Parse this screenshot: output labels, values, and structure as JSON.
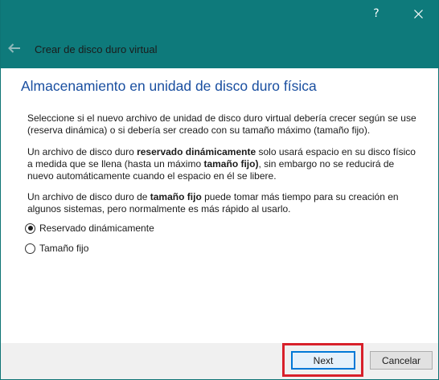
{
  "titlebar": {
    "help_label": "?",
    "close_icon": "close-icon",
    "background_color": "#0e7a7b"
  },
  "wizard": {
    "back_icon": "back-arrow-icon",
    "title": "Crear de disco duro virtual"
  },
  "page": {
    "heading": "Almacenamiento en unidad de disco duro física",
    "heading_color": "#1a4fa0",
    "paragraph1": "Seleccione si el nuevo archivo de unidad de disco duro virtual debería crecer según se use (reserva dinámica) o si debería ser creado con su tamaño máximo (tamaño fijo).",
    "paragraph2": {
      "part1": "Un archivo de disco duro ",
      "bold1": "reservado dinámicamente",
      "part2": " solo usará espacio en su disco físico a medida que se llena (hasta un máximo ",
      "bold2": "tamaño fijo)",
      "part3": ", sin embargo no se reducirá de nuevo automáticamente cuando el espacio en él se libere."
    },
    "paragraph3": {
      "part1": "Un archivo de disco duro de ",
      "bold1": "tamaño fijo",
      "part2": " puede tomar más tiempo para su creación en algunos sistemas, pero normalmente es más rápido al usarlo."
    }
  },
  "options": {
    "selected": "dynamic",
    "dynamic_label": "Reservado dinámicamente",
    "fixed_label": "Tamaño fijo"
  },
  "footer": {
    "next_label": "Next",
    "cancel_label": "Cancelar",
    "highlight_color": "#d8202a"
  }
}
